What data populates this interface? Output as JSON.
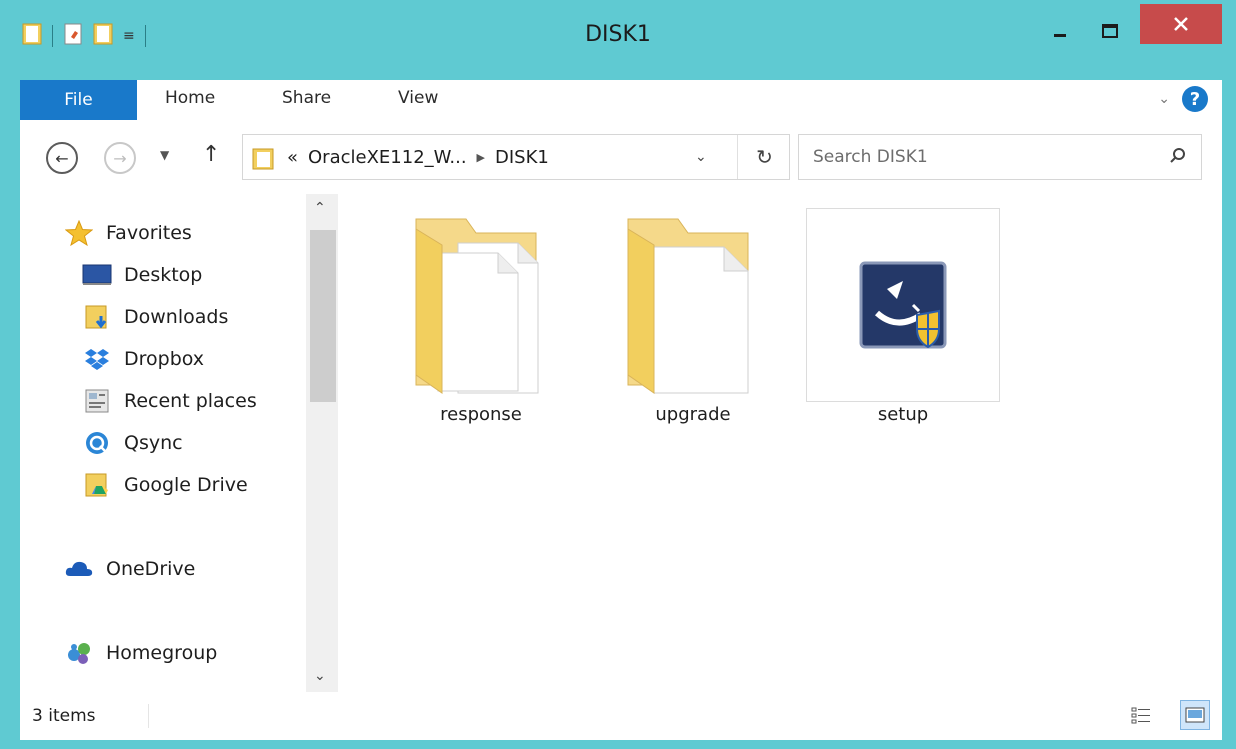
{
  "window": {
    "title": "DISK1",
    "minimize_icon": "minimize-icon",
    "maximize_icon": "maximize-icon",
    "close_icon": "close-icon"
  },
  "ribbon": {
    "tabs": [
      {
        "label": "File",
        "active": true
      },
      {
        "label": "Home"
      },
      {
        "label": "Share"
      },
      {
        "label": "View"
      }
    ]
  },
  "address": {
    "overflow": "«",
    "crumbs": [
      "OracleXE112_W...",
      "DISK1"
    ],
    "refresh_icon": "refresh-icon"
  },
  "search": {
    "placeholder": "Search DISK1"
  },
  "navpane": {
    "favorites_label": "Favorites",
    "favorites": [
      {
        "label": "Desktop",
        "icon": "desktop-icon"
      },
      {
        "label": "Downloads",
        "icon": "downloads-folder-icon"
      },
      {
        "label": "Dropbox",
        "icon": "dropbox-icon"
      },
      {
        "label": "Recent places",
        "icon": "recent-places-icon"
      },
      {
        "label": "Qsync",
        "icon": "qsync-icon"
      },
      {
        "label": "Google Drive",
        "icon": "google-drive-icon"
      }
    ],
    "onedrive_label": "OneDrive",
    "homegroup_label": "Homegroup"
  },
  "files": [
    {
      "name": "response",
      "type": "folder"
    },
    {
      "name": "upgrade",
      "type": "folder"
    },
    {
      "name": "setup",
      "type": "application"
    }
  ],
  "status": {
    "item_count": "3 items"
  },
  "colors": {
    "frame": "#5fcad2",
    "file_tab": "#1979ca",
    "close_button": "#c74b4b"
  }
}
